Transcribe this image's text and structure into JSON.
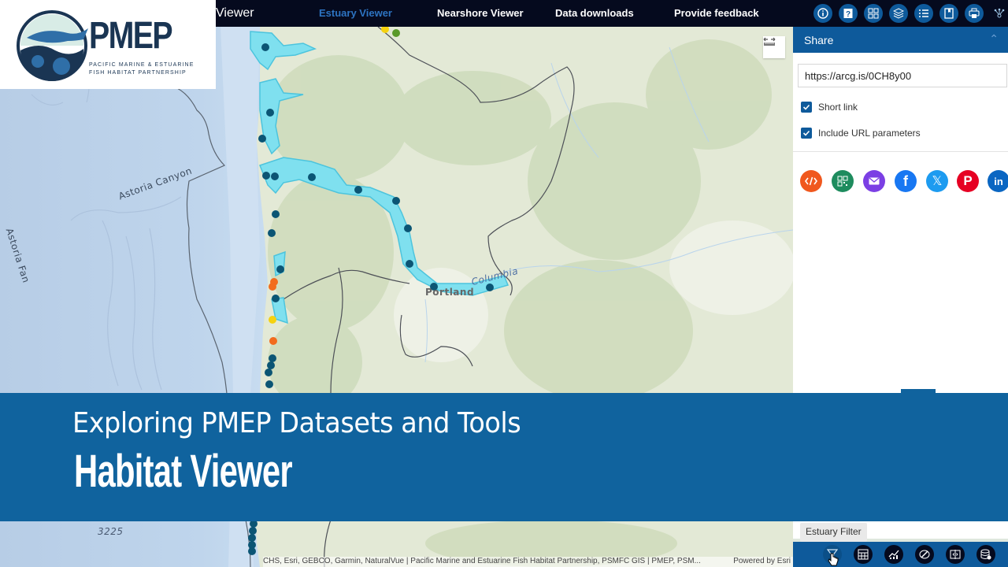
{
  "app": {
    "title_partial": "Viewer",
    "logo": {
      "brand": "PMEP",
      "tagline_line1": "PACIFIC MARINE & ESTUARINE",
      "tagline_line2": "FISH HABITAT PARTNERSHIP"
    }
  },
  "nav": {
    "items": [
      {
        "label": "Estuary Viewer",
        "active": true
      },
      {
        "label": "Nearshore Viewer",
        "active": false
      },
      {
        "label": "Data downloads",
        "active": false
      },
      {
        "label": "Provide feedback",
        "active": false
      }
    ]
  },
  "header_tools": [
    {
      "icon": "info-icon",
      "label": "About"
    },
    {
      "icon": "help-icon",
      "label": "Help"
    },
    {
      "icon": "basemap-gallery-icon",
      "label": "Basemap Gallery"
    },
    {
      "icon": "layers-icon",
      "label": "Layers"
    },
    {
      "icon": "legend-icon",
      "label": "Legend"
    },
    {
      "icon": "bookmark-icon",
      "label": "Bookmarks"
    },
    {
      "icon": "print-icon",
      "label": "Print"
    },
    {
      "icon": "share-icon",
      "label": "Share"
    }
  ],
  "map": {
    "labels": {
      "astoria_canyon": "Astoria Canyon",
      "astoria_fan": "Astoria Fan",
      "portland": "Portland",
      "columbia": "Columbia",
      "depth": "3225"
    },
    "marker_colors": {
      "estuary": "#0b5574",
      "orange": "#f26b1d",
      "yellow": "#f5d20f",
      "green": "#5a9a2a",
      "estuary_fill": "#7fe0ef"
    },
    "attribution": "CHS, Esri, GEBCO, Garmin, NaturalVue | Pacific Marine and Estuarine Fish Habitat Partnership, PSMFC GIS | PMEP, PSM...",
    "powered_by": "Powered by Esri"
  },
  "share_panel": {
    "title": "Share",
    "url": "https://arcg.is/0CH8y00",
    "options": [
      {
        "label": "Short link",
        "checked": true
      },
      {
        "label": "Include URL parameters",
        "checked": true
      }
    ],
    "social": [
      {
        "name": "embed",
        "color": "#f0581e"
      },
      {
        "name": "qr-code",
        "color": "#1e8c5e"
      },
      {
        "name": "email",
        "color": "#7b3fe4"
      },
      {
        "name": "facebook",
        "color": "#1877f2"
      },
      {
        "name": "x",
        "color": "#1d9bf0"
      },
      {
        "name": "pinterest",
        "color": "#e60023"
      },
      {
        "name": "linkedin",
        "color": "#0a66c2"
      }
    ]
  },
  "bottom_toolbar": {
    "tooltip": "Estuary Filter",
    "tools": [
      {
        "icon": "filter-icon",
        "label": "Estuary Filter"
      },
      {
        "icon": "table-icon",
        "label": "Attribute Table"
      },
      {
        "icon": "chart-icon",
        "label": "Chart"
      },
      {
        "icon": "draw-icon",
        "label": "Draw"
      },
      {
        "icon": "swipe-icon",
        "label": "Swipe"
      },
      {
        "icon": "data-icon",
        "label": "Data"
      }
    ]
  },
  "banner": {
    "subtitle": "Exploring PMEP Datasets and Tools",
    "title": "Habitat Viewer",
    "color": "#10639e"
  }
}
